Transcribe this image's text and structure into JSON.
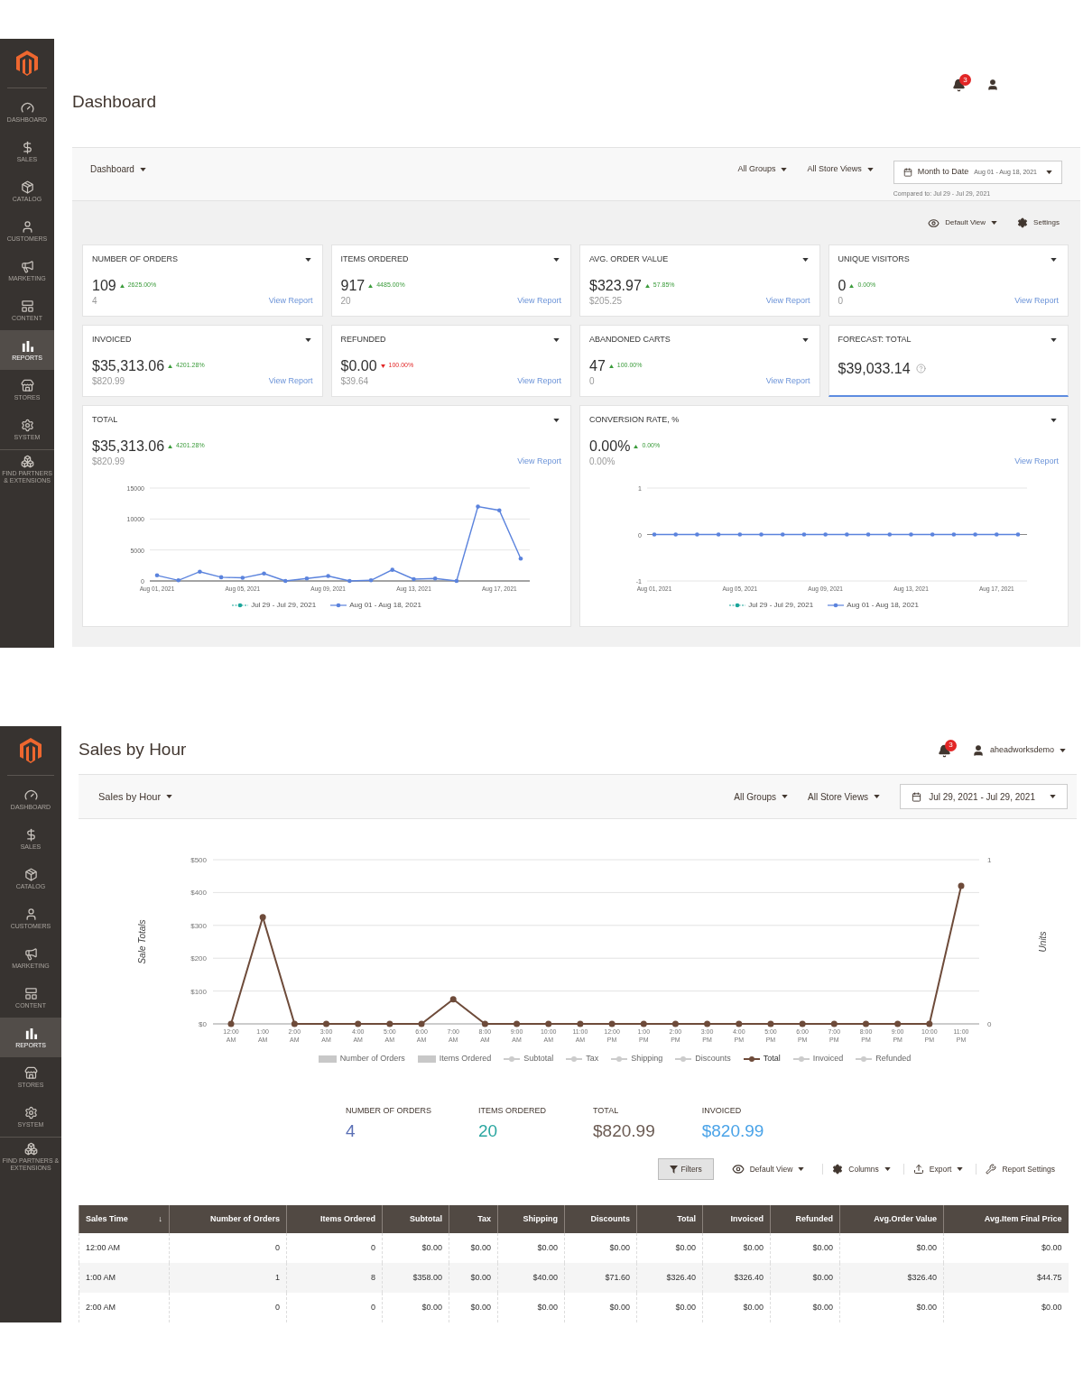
{
  "dashboard": {
    "sidebar": [
      {
        "label": "DASHBOARD",
        "selected": false
      },
      {
        "label": "SALES",
        "selected": false
      },
      {
        "label": "CATALOG",
        "selected": false
      },
      {
        "label": "CUSTOMERS",
        "selected": false
      },
      {
        "label": "MARKETING",
        "selected": false
      },
      {
        "label": "CONTENT",
        "selected": false
      },
      {
        "label": "REPORTS",
        "selected": true
      },
      {
        "label": "STORES",
        "selected": false
      },
      {
        "label": "SYSTEM",
        "selected": false
      },
      {
        "label": "FIND PARTNERS & EXTENSIONS",
        "selected": false
      }
    ],
    "title": "Dashboard",
    "notifications": "3",
    "switcher": "Dashboard",
    "filters": [
      "All Groups",
      "All Store Views"
    ],
    "date_range": {
      "label": "Month to Date",
      "range": "Aug 01 - Aug 18, 2021",
      "compared": "Compared to: Jul 29 - Jul 29, 2021"
    },
    "view": "Default View",
    "settings": "Settings",
    "cards": [
      {
        "kind": "metric",
        "title": "NUMBER OF ORDERS",
        "value": "109",
        "change": "2625.00%",
        "increase": true,
        "previous": "4",
        "link": "View Report"
      },
      {
        "kind": "metric",
        "title": "ITEMS ORDERED",
        "value": "917",
        "change": "4485.00%",
        "increase": true,
        "previous": "20",
        "link": "View Report"
      },
      {
        "kind": "metric",
        "title": "AVG. ORDER VALUE",
        "value": "$323.97",
        "change": "57.85%",
        "increase": true,
        "previous": "$205.25",
        "link": "View Report"
      },
      {
        "kind": "metric",
        "title": "UNIQUE VISITORS",
        "value": "0",
        "change": "0.00%",
        "increase": true,
        "previous": "0",
        "link": "View Report"
      },
      {
        "kind": "metric",
        "title": "INVOICED",
        "value": "$35,313.06",
        "change": "4201.28%",
        "increase": true,
        "previous": "$820.99",
        "link": "View Report"
      },
      {
        "kind": "metric",
        "title": "REFUNDED",
        "value": "$0.00",
        "change": "100.00%",
        "increase": false,
        "previous": "$39.64",
        "link": "View Report"
      },
      {
        "kind": "metric",
        "title": "ABANDONED CARTS",
        "value": "47",
        "change": "100.00%",
        "increase": true,
        "previous": "0",
        "link": "View Report"
      },
      {
        "kind": "forecast",
        "title": "FORECAST: TOTAL",
        "value": "$39,033.14"
      }
    ],
    "chart_cards": [
      {
        "title": "TOTAL",
        "value": "$35,313.06",
        "change": "4201.28%",
        "increase": true,
        "previous": "$820.99",
        "link": "View Report",
        "legend_dashed": [
          true,
          false
        ],
        "chart_data": {
          "type": "line",
          "grid": true,
          "categories": [
            "Aug 01, 2021",
            null,
            null,
            null,
            "Aug 05, 2021",
            null,
            null,
            null,
            "Aug 09, 2021",
            null,
            null,
            null,
            "Aug 13, 2021",
            null,
            null,
            null,
            "Aug 17, 2021",
            null
          ],
          "series": [
            {
              "name": "Jul 29 - Jul 29, 2021",
              "color": "#1aa59a",
              "values": [
                null,
                null,
                null,
                null,
                null,
                null,
                null,
                null,
                null,
                null,
                null,
                null,
                null,
                null,
                null,
                null,
                null,
                null
              ]
            },
            {
              "name": "Aug 01 - Aug 18, 2021",
              "color": "#5b83dd",
              "values": [
                900,
                100,
                1500,
                600,
                500,
                1200,
                0,
                400,
                800,
                0,
                100,
                1800,
                300,
                400,
                0,
                12000,
                11400,
                3600
              ]
            }
          ],
          "ylim": [
            0,
            15000
          ],
          "yticks": [
            0,
            5000,
            10000,
            15000
          ]
        }
      },
      {
        "title": "CONVERSION RATE, %",
        "value": "0.00%",
        "change": "0.00%",
        "increase": true,
        "previous": "0.00%",
        "link": "View Report",
        "legend_dashed": [
          true,
          false
        ],
        "chart_data": {
          "type": "line",
          "grid": true,
          "categories": [
            "Aug 01, 2021",
            null,
            null,
            null,
            "Aug 05, 2021",
            null,
            null,
            null,
            "Aug 09, 2021",
            null,
            null,
            null,
            "Aug 13, 2021",
            null,
            null,
            null,
            "Aug 17, 2021",
            null
          ],
          "series": [
            {
              "name": "Jul 29 - Jul 29, 2021",
              "color": "#1aa59a",
              "values": [
                null,
                null,
                null,
                null,
                null,
                null,
                null,
                null,
                null,
                null,
                null,
                null,
                null,
                null,
                null,
                null,
                null,
                null
              ]
            },
            {
              "name": "Aug 01 - Aug 18, 2021",
              "color": "#5b83dd",
              "values": [
                0,
                0,
                0,
                0,
                0,
                0,
                0,
                0,
                0,
                0,
                0,
                0,
                0,
                0,
                0,
                0,
                0,
                0
              ]
            }
          ],
          "ylim": [
            -1,
            1
          ],
          "yticks": [
            -1,
            0,
            1
          ]
        }
      }
    ]
  },
  "sales_by_hour": {
    "sidebar": [
      {
        "label": "DASHBOARD",
        "selected": false
      },
      {
        "label": "SALES",
        "selected": false
      },
      {
        "label": "CATALOG",
        "selected": false
      },
      {
        "label": "CUSTOMERS",
        "selected": false
      },
      {
        "label": "MARKETING",
        "selected": false
      },
      {
        "label": "CONTENT",
        "selected": false
      },
      {
        "label": "REPORTS",
        "selected": true
      },
      {
        "label": "STORES",
        "selected": false
      },
      {
        "label": "SYSTEM",
        "selected": false
      },
      {
        "label": "FIND PARTNERS & EXTENSIONS",
        "selected": false
      }
    ],
    "title": "Sales by Hour",
    "notifications": "3",
    "user": "aheadworksdemo",
    "switcher": "Sales by Hour",
    "filters": [
      "All Groups",
      "All Store Views"
    ],
    "date_range": "Jul 29, 2021 - Jul 29, 2021",
    "chart": {
      "right_axis": {
        "label": "Units",
        "ticks": [
          "1",
          "0"
        ]
      },
      "legend": [
        {
          "label": "Number of Orders",
          "kind": "bar",
          "enabled": false
        },
        {
          "label": "Items Ordered",
          "kind": "bar",
          "enabled": false
        },
        {
          "label": "Subtotal",
          "kind": "line",
          "enabled": false
        },
        {
          "label": "Tax",
          "kind": "line",
          "enabled": false
        },
        {
          "label": "Shipping",
          "kind": "line",
          "enabled": false
        },
        {
          "label": "Discounts",
          "kind": "line",
          "enabled": false
        },
        {
          "kind": "series",
          "enabled": true
        },
        {
          "label": "Invoiced",
          "kind": "line",
          "enabled": false
        },
        {
          "label": "Refunded",
          "kind": "line",
          "enabled": false
        }
      ],
      "chart_data": {
        "type": "line",
        "ylabel": "Sale Totals",
        "grid": true,
        "categories": [
          "12:00 AM",
          "1:00 AM",
          "2:00 AM",
          "3:00 AM",
          "4:00 AM",
          "5:00 AM",
          "6:00 AM",
          "7:00 AM",
          "8:00 AM",
          "9:00 AM",
          "10:00 AM",
          "11:00 AM",
          "12:00 PM",
          "1:00 PM",
          "2:00 PM",
          "3:00 PM",
          "4:00 PM",
          "5:00 PM",
          "6:00 PM",
          "7:00 PM",
          "8:00 PM",
          "9:00 PM",
          "10:00 PM",
          "11:00 PM"
        ],
        "series": [
          {
            "name": "Total",
            "color": "#6e4b3a",
            "marker": "circle",
            "values": [
              0,
              325,
              0,
              0,
              0,
              0,
              0,
              75,
              0,
              0,
              0,
              0,
              0,
              0,
              0,
              0,
              0,
              0,
              0,
              0,
              0,
              0,
              0,
              420
            ]
          }
        ],
        "ylim": [
          0,
          500
        ],
        "yticks": [
          {
            "value": 0,
            "label": "$0"
          },
          {
            "value": 100,
            "label": "$100"
          },
          {
            "value": 200,
            "label": "$200"
          },
          {
            "value": 300,
            "label": "$300"
          },
          {
            "value": 400,
            "label": "$400"
          },
          {
            "value": 500,
            "label": "$500"
          }
        ]
      }
    },
    "totals": [
      {
        "label": "NUMBER OF ORDERS",
        "value": "4",
        "color": "#5a6fb5"
      },
      {
        "label": "ITEMS ORDERED",
        "value": "20",
        "color": "#2aa6a0"
      },
      {
        "label": "TOTAL",
        "value": "$820.99",
        "color": "#6b5b53"
      },
      {
        "label": "INVOICED",
        "value": "$820.99",
        "color": "#4aa3e8"
      }
    ],
    "toolbar": {
      "filters": "Filters",
      "view": "Default View",
      "columns": "Columns",
      "export": "Export",
      "settings": "Report Settings"
    },
    "table": {
      "columns": [
        {
          "label": "Sales Time",
          "sort": "↓"
        },
        {
          "label": "Number of Orders"
        },
        {
          "label": "Items Ordered"
        },
        {
          "label": "Subtotal"
        },
        {
          "label": "Tax"
        },
        {
          "label": "Shipping"
        },
        {
          "label": "Discounts"
        },
        {
          "label": "Total"
        },
        {
          "label": "Invoiced"
        },
        {
          "label": "Refunded"
        },
        {
          "label": "Avg.Order Value"
        },
        {
          "label": "Avg.Item Final Price"
        }
      ],
      "rows": [
        [
          "12:00 AM",
          "0",
          "0",
          "$0.00",
          "$0.00",
          "$0.00",
          "$0.00",
          "$0.00",
          "$0.00",
          "$0.00",
          "$0.00",
          "$0.00"
        ],
        [
          "1:00 AM",
          "1",
          "8",
          "$358.00",
          "$0.00",
          "$40.00",
          "$71.60",
          "$326.40",
          "$326.40",
          "$0.00",
          "$326.40",
          "$44.75"
        ],
        [
          "2:00 AM",
          "0",
          "0",
          "$0.00",
          "$0.00",
          "$0.00",
          "$0.00",
          "$0.00",
          "$0.00",
          "$0.00",
          "$0.00",
          "$0.00"
        ]
      ]
    }
  }
}
